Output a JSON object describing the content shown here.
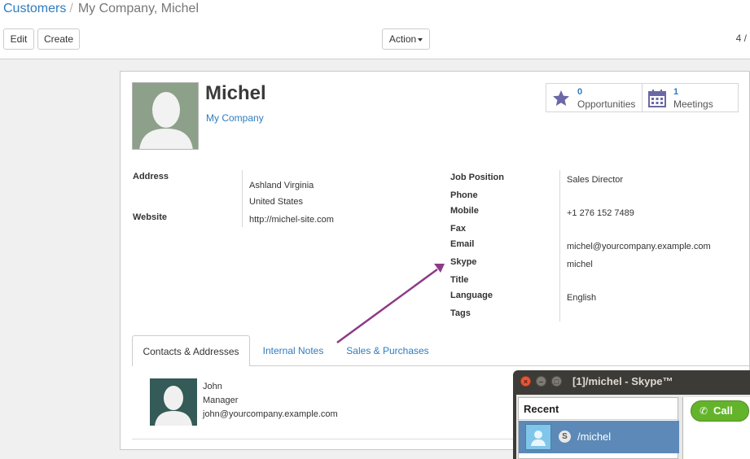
{
  "breadcrumb": {
    "parent": "Customers",
    "separator": "/",
    "current": "My Company, Michel"
  },
  "toolbar": {
    "edit": "Edit",
    "create": "Create",
    "action": "Action",
    "pager": "4 /"
  },
  "partner": {
    "name": "Michel",
    "company": "My Company"
  },
  "stat_buttons": [
    {
      "count": "0",
      "label": "Opportunities",
      "icon": "star-icon"
    },
    {
      "count": "1",
      "label": "Meetings",
      "icon": "calendar-icon"
    }
  ],
  "left_fields": {
    "address_label": "Address",
    "address_line1": "Ashland  Virginia",
    "address_line2": "United States",
    "website_label": "Website",
    "website_value": "http://michel-site.com"
  },
  "right_fields": {
    "job_position_label": "Job Position",
    "job_position_value": "Sales Director",
    "phone_label": "Phone",
    "mobile_label": "Mobile",
    "mobile_value": "+1 276 152 7489",
    "fax_label": "Fax",
    "email_label": "Email",
    "email_value": "michel@yourcompany.example.com",
    "skype_label": "Skype",
    "skype_value": "michel",
    "title_label": "Title",
    "language_label": "Language",
    "language_value": "English",
    "tags_label": "Tags"
  },
  "tabs": [
    "Contacts & Addresses",
    "Internal Notes",
    "Sales & Purchases"
  ],
  "contact": {
    "name": "John",
    "function": "Manager",
    "email": "john@yourcompany.example.com"
  },
  "skype_window": {
    "title": "[1]/michel - Skype™",
    "close": "×",
    "minimize": "–",
    "maximize": "□",
    "recent_header": "Recent",
    "recent_item": "/michel",
    "call_button": "Call"
  },
  "colors": {
    "link": "#2f7cbf",
    "annotation_arrow": "#8e3a86",
    "skype_call": "#63b42b",
    "skype_selected": "#5c89b7"
  }
}
